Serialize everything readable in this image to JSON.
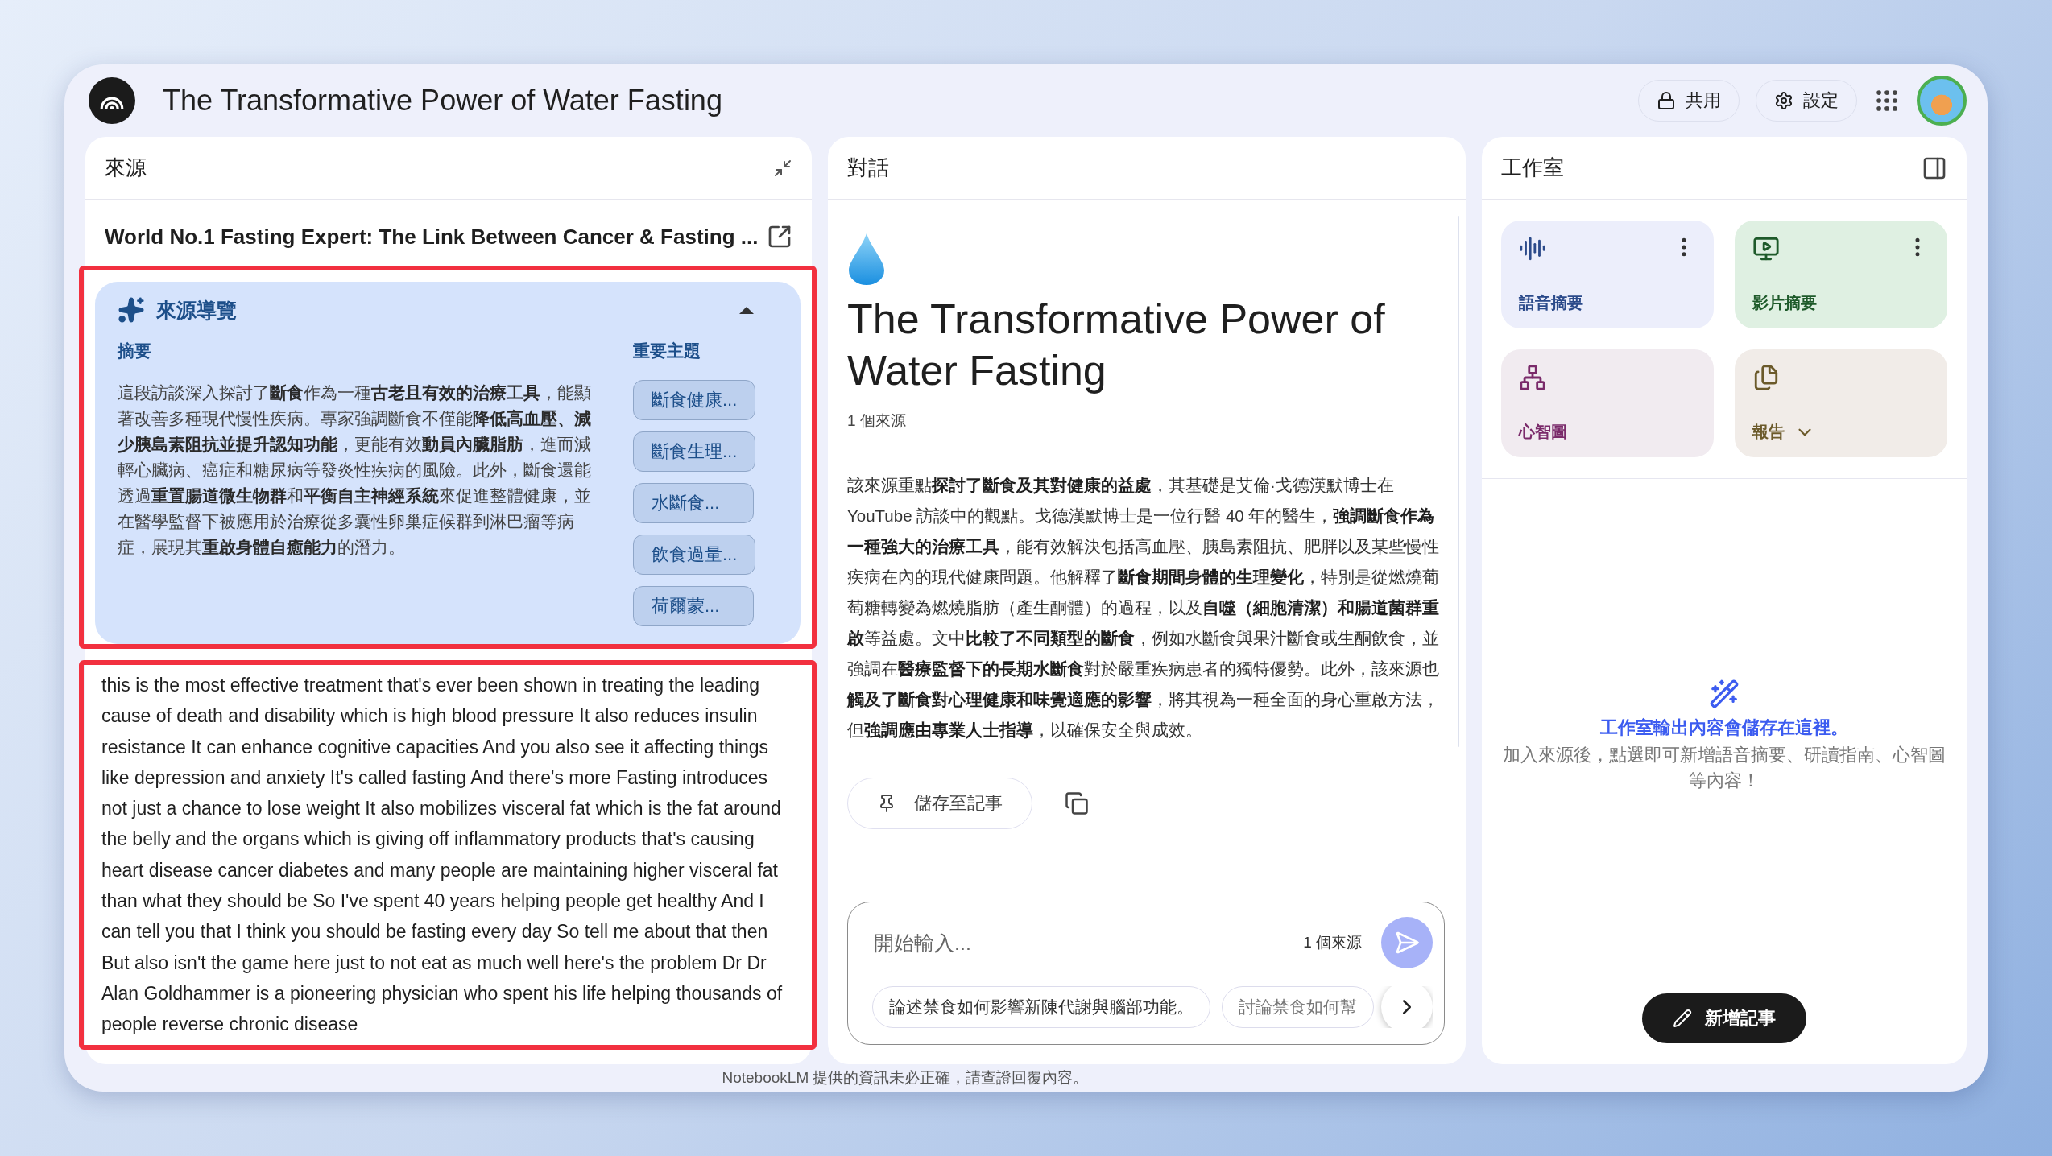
{
  "app": {
    "title": "The Transformative Power of Water Fasting"
  },
  "header_actions": [
    {
      "kind": "share",
      "label": "共用"
    },
    {
      "kind": "settings",
      "label": "設定"
    }
  ],
  "sources_panel": {
    "title": "來源",
    "source_title": "World No.1 Fasting Expert: The Link Between Cancer & Fasting ...",
    "overview": {
      "highlighted": true,
      "title": "來源導覽",
      "expanded": true,
      "summary_label": "摘要",
      "summary": "這段訪談深入探討了**斷食**作為一種**古老且有效的治療工具**，能顯著改善多種現代慢性疾病。專家強調斷食不僅能**降低高血壓、減少胰島素阻抗並提升認知功能**，更能有效**動員內臟脂肪**，進而減輕心臟病、癌症和糖尿病等發炎性疾病的風險。此外，斷食還能透過**重置腸道微生物群**和**平衡自主神經系統**來促進整體健康，並在醫學監督下被應用於治療從多囊性卵巢症候群到淋巴瘤等病症，展現其**重啟身體自癒能力**的潛力。",
      "topics_label": "重要主題",
      "topics": [
        "斷食健康...",
        "斷食生理...",
        "水斷食...",
        "飲食過量...",
        "荷爾蒙..."
      ]
    },
    "transcript": {
      "highlighted": true,
      "text": "this is the most effective treatment that's ever been shown in treating the leading cause of death and disability which is high blood pressure It also reduces insulin resistance It can enhance cognitive capacities And you also see it affecting things like depression and anxiety It's called fasting And there's more Fasting introduces not just a chance to lose weight It also mobilizes visceral fat which is the fat around the belly and the organs which is giving off inflammatory products that's causing heart disease cancer diabetes and many people are maintaining higher visceral fat than what they should be So I've spent 40 years helping people get healthy And I can tell you that I think you should be fasting every day So tell me about that then But also isn't the game here just to not eat as much well here's the problem Dr Dr Alan Goldhammer is a pioneering physician who spent his life helping thousands of people reverse chronic disease"
    }
  },
  "chat_panel": {
    "title": "對話",
    "notebook_title": "The Transformative Power of Water Fasting",
    "source_count": "1 個來源",
    "summary": "該來源重點**探討了斷食及其對健康的益處**，其基礎是艾倫·戈德漢默博士在 YouTube 訪談中的觀點。戈德漢默博士是一位行醫 40 年的醫生，**強調斷食作為一種強大的治療工具**，能有效解決包括高血壓、胰島素阻抗、肥胖以及某些慢性疾病在內的現代健康問題。他解釋了**斷食期間身體的生理變化**，特別是從燃燒葡萄糖轉變為燃燒脂肪（產生酮體）的過程，以及**自噬（細胞清潔）和腸道菌群重啟**等益處。文中**比較了不同類型的斷食**，例如水斷食與果汁斷食或生酮飲食，並強調在**醫療監督下的長期水斷食**對於嚴重疾病患者的獨特優勢。此外，該來源也**觸及了斷食對心理健康和味覺適應的影響**，將其視為一種全面的身心重啟方法，但**強調應由專業人士指導**，以確保安全與成效。",
    "save_button": "儲存至記事",
    "input": {
      "placeholder": "開始輸入...",
      "source_count": "1 個來源",
      "send_disabled": true
    },
    "suggestions": [
      "論述禁食如何影響新陳代謝與腦部功能。",
      "討論禁食如何幫"
    ]
  },
  "studio_panel": {
    "title": "工作室",
    "tools": [
      {
        "kind": "audio",
        "label": "語音摘要",
        "color": "#2b4a8a",
        "menu": true
      },
      {
        "kind": "video",
        "label": "影片摘要",
        "color": "#1e5a2a",
        "menu": true
      },
      {
        "kind": "mindmap",
        "label": "心智圖",
        "color": "#7a2a6a",
        "menu": false
      },
      {
        "kind": "report",
        "label": "報告",
        "color": "#6b5a2a",
        "menu": false
      }
    ],
    "empty_title": "工作室輸出內容會儲存在這裡。",
    "empty_text": "加入來源後，點選即可新增語音摘要、研讀指南、心智圖等內容！",
    "add_note_button": "新增記事"
  },
  "footer_note": "NotebookLM 提供的資訊未必正確，請查證回覆內容。"
}
